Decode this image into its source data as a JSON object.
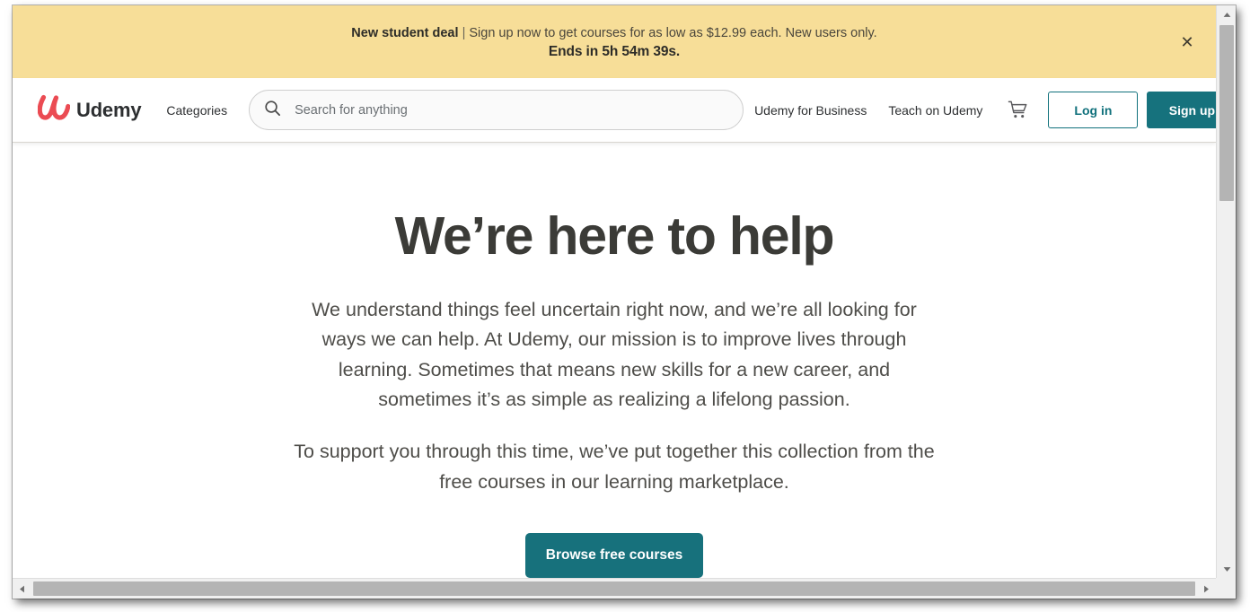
{
  "banner": {
    "deal_label": "New student deal",
    "separator": "|",
    "message": "Sign up now to get courses for as low as $12.99 each. New users only.",
    "countdown": "Ends in 5h 54m 39s.",
    "close_icon": "close-icon",
    "background_color": "#F7DE98"
  },
  "header": {
    "logo_text": "Udemy",
    "logo_color": "#EB4B53",
    "categories_label": "Categories",
    "search": {
      "placeholder": "Search for anything",
      "value": "",
      "icon": "search-icon"
    },
    "nav_links": [
      {
        "label": "Udemy for Business"
      },
      {
        "label": "Teach on Udemy"
      }
    ],
    "cart_icon": "shopping-cart-icon",
    "login_label": "Log in",
    "signup_label": "Sign up",
    "accent_color": "#16727D"
  },
  "main": {
    "title": "We’re here to help",
    "paragraph_1": "We understand things feel uncertain right now, and we’re all looking for ways we can help. At Udemy, our mission is to improve lives through learning. Sometimes that means new skills for a new career, and sometimes it’s as simple as realizing a lifelong passion.",
    "paragraph_2": "To support you through this time, we’ve put together this collection from the free courses in our learning marketplace.",
    "cta_label": "Browse free courses"
  },
  "scrollbars": {
    "vertical_up_icon": "chevron-up-icon",
    "vertical_down_icon": "chevron-down-icon",
    "horizontal_left_icon": "chevron-left-icon",
    "horizontal_right_icon": "chevron-right-icon"
  }
}
